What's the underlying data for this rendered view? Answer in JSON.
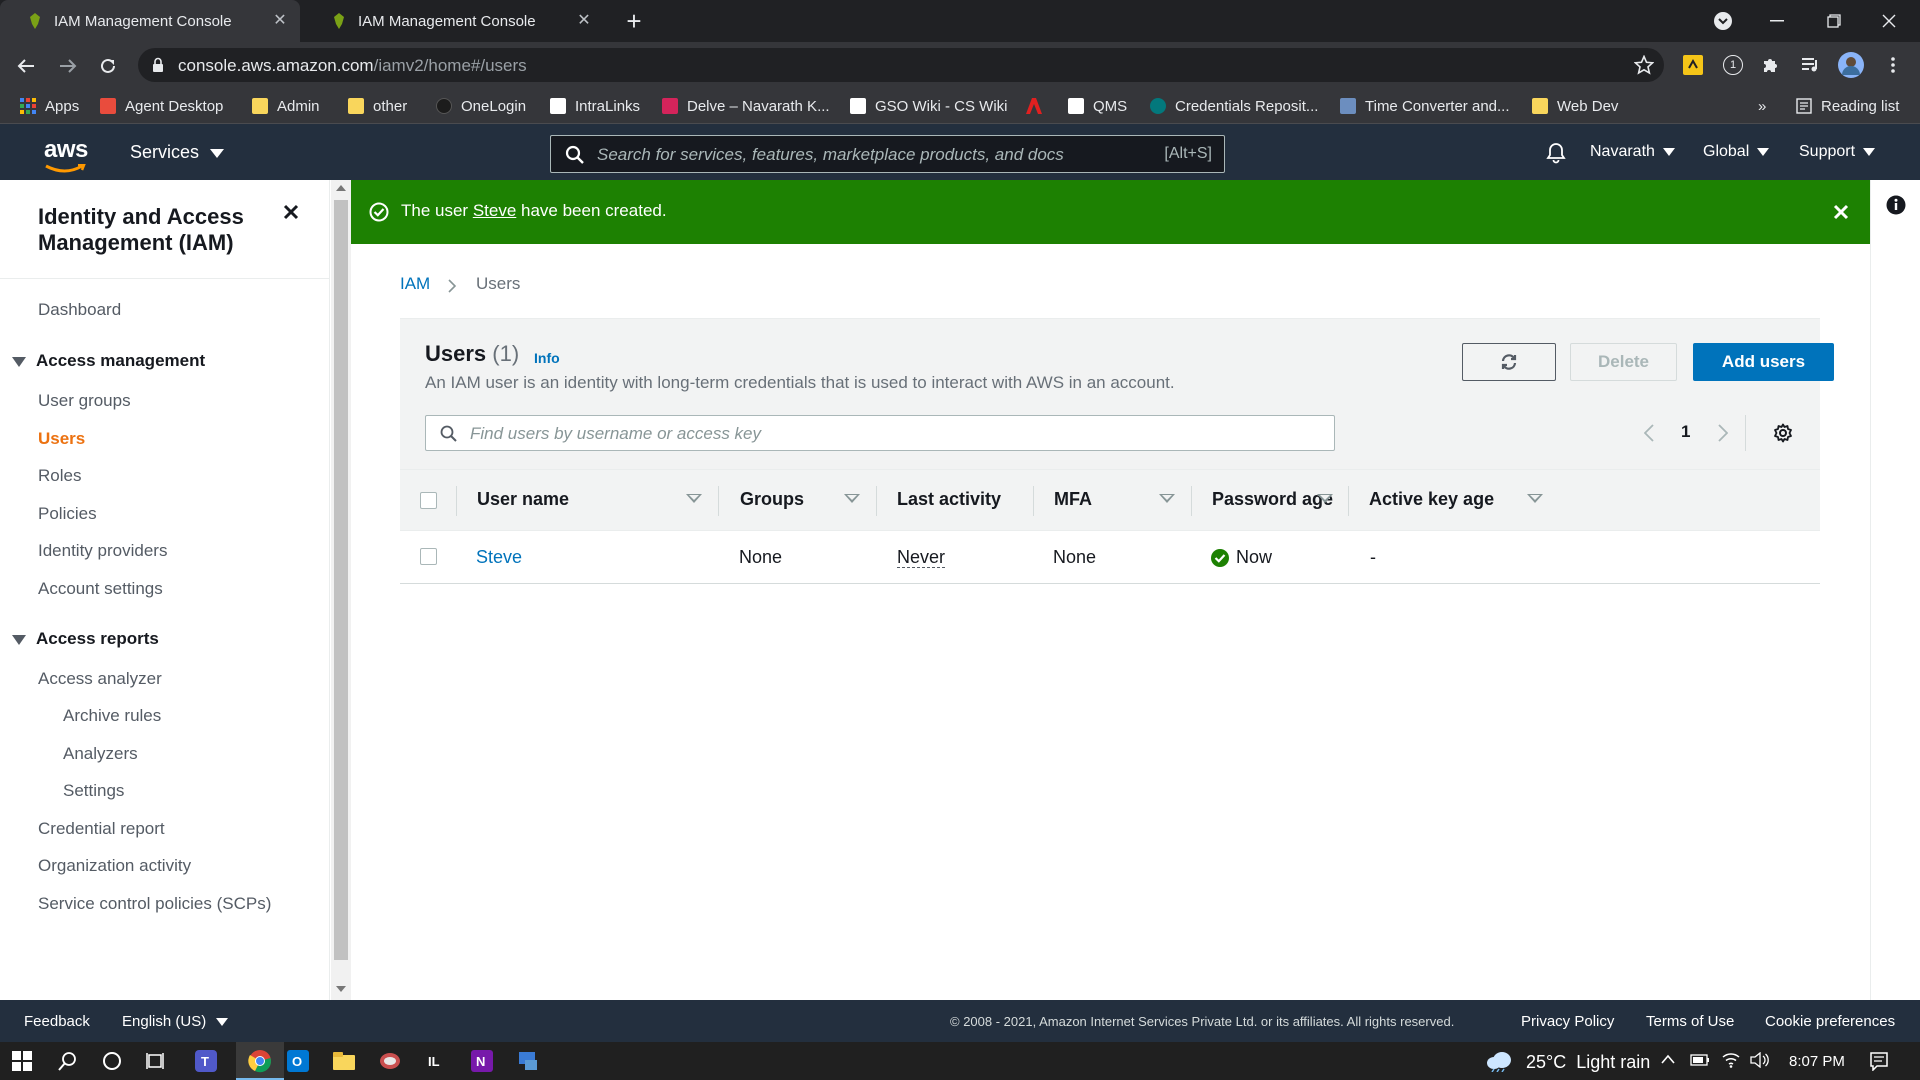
{
  "browser": {
    "tabs": [
      {
        "title": "IAM Management Console",
        "active": true
      },
      {
        "title": "IAM Management Console",
        "active": false
      }
    ],
    "url_host": "console.aws.amazon.com",
    "url_path": "/iamv2/home#/users",
    "ext_badge": "1",
    "bookmarks": [
      {
        "label": "Apps",
        "color": "#4285f4"
      },
      {
        "label": "Agent Desktop",
        "color": "#e94c3d"
      },
      {
        "label": "Admin",
        "color": "#f9d65c"
      },
      {
        "label": "other",
        "color": "#f9d65c"
      },
      {
        "label": "OneLogin",
        "color": "#1c1c1c"
      },
      {
        "label": "IntraLinks",
        "color": "#ffffff"
      },
      {
        "label": "Delve – Navarath K...",
        "color": "#d4245b"
      },
      {
        "label": "GSO Wiki - CS Wiki",
        "color": "#ffffff"
      },
      {
        "label": "",
        "color": "#e02020"
      },
      {
        "label": "QMS",
        "color": "#ffffff"
      },
      {
        "label": "Credentials Reposit...",
        "color": "#03787c"
      },
      {
        "label": "Time Converter and...",
        "color": "#6c8ebf"
      },
      {
        "label": "Web Dev",
        "color": "#f9d65c"
      }
    ],
    "more_bookmarks": "»",
    "reading_list": "Reading list"
  },
  "aws_nav": {
    "logo": "aws",
    "services": "Services",
    "search_placeholder": "Search for services, features, marketplace products, and docs",
    "search_shortcut": "[Alt+S]",
    "user": "Navarath",
    "region": "Global",
    "support": "Support"
  },
  "sidebar": {
    "title": "Identity and Access Management (IAM)",
    "dashboard": "Dashboard",
    "access_management": {
      "heading": "Access management",
      "items": [
        "User groups",
        "Users",
        "Roles",
        "Policies",
        "Identity providers",
        "Account settings"
      ],
      "active": "Users"
    },
    "access_reports": {
      "heading": "Access reports",
      "items": [
        "Access analyzer",
        "Archive rules",
        "Analyzers",
        "Settings",
        "Credential report",
        "Organization activity",
        "Service control policies (SCPs)"
      ]
    }
  },
  "flash": {
    "prefix": "The user ",
    "user": "Steve",
    "suffix": " have been created."
  },
  "breadcrumb": {
    "root": "IAM",
    "current": "Users"
  },
  "users_panel": {
    "title": "Users",
    "count": "(1)",
    "info": "Info",
    "description": "An IAM user is an identity with long-term credentials that is used to interact with AWS in an account.",
    "delete_label": "Delete",
    "add_label": "Add users",
    "filter_placeholder": "Find users by username or access key",
    "page": "1",
    "columns": [
      "User name",
      "Groups",
      "Last activity",
      "MFA",
      "Password age",
      "Active key age"
    ],
    "rows": [
      {
        "user_name": "Steve",
        "groups": "None",
        "last_activity": "Never",
        "mfa": "None",
        "password_age": "Now",
        "active_key_age": "-"
      }
    ]
  },
  "footer": {
    "feedback": "Feedback",
    "language": "English (US)",
    "copyright": "© 2008 - 2021, Amazon Internet Services Private Ltd. or its affiliates. All rights reserved.",
    "privacy": "Privacy Policy",
    "terms": "Terms of Use",
    "cookies": "Cookie preferences"
  },
  "taskbar": {
    "weather": "25°C  Light rain",
    "time": "8:07 PM"
  },
  "colors": {
    "aws_nav": "#232f3e",
    "success": "#1d8102",
    "link": "#0073bb",
    "primary_button": "#0073bb",
    "active_nav": "#ec7211"
  }
}
